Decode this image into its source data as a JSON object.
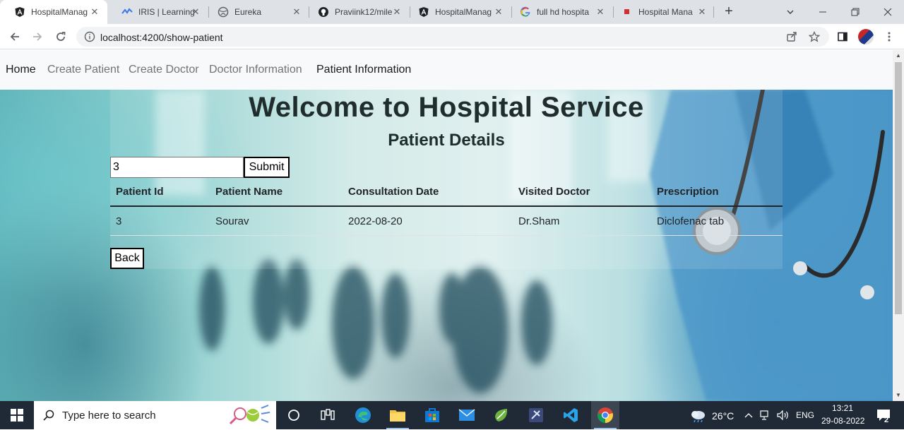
{
  "browser": {
    "tabs": [
      {
        "title": "HospitalManag",
        "icon": "angular-icon",
        "active": true
      },
      {
        "title": "IRIS | Learning",
        "icon": "iris-icon",
        "active": false
      },
      {
        "title": "Eureka",
        "icon": "globe-icon",
        "active": false
      },
      {
        "title": "Praviink12/mile",
        "icon": "github-icon",
        "active": false
      },
      {
        "title": "HospitalManag",
        "icon": "angular-icon",
        "active": false
      },
      {
        "title": "full hd hospita",
        "icon": "google-icon",
        "active": false
      },
      {
        "title": "Hospital Mana",
        "icon": "red-square-icon",
        "active": false
      }
    ],
    "url": "localhost:4200/show-patient"
  },
  "navbar": {
    "brand": "Home",
    "links": [
      "Create Patient",
      "Create Doctor",
      "Doctor Information",
      "Patient Information"
    ]
  },
  "main": {
    "welcome": "Welcome to Hospital Service",
    "subtitle": "Patient Details",
    "search_value": "3",
    "submit_label": "Submit",
    "back_label": "Back",
    "table": {
      "headers": [
        "Patient Id",
        "Patient Name",
        "Consultation Date",
        "Visited Doctor",
        "Prescription"
      ],
      "rows": [
        [
          "3",
          "Sourav",
          "2022-08-20",
          "Dr.Sham",
          "Diclofenac tab"
        ]
      ]
    }
  },
  "taskbar": {
    "search_placeholder": "Type here to search",
    "temperature": "26°C",
    "language": "ENG",
    "time": "13:21",
    "date": "29-08-2022",
    "notification_count": "2"
  },
  "colors": {
    "navbar_bg": "#f8f9fa",
    "taskbar_bg": "#1f2a36",
    "tabbar_bg": "#dee1e6"
  }
}
